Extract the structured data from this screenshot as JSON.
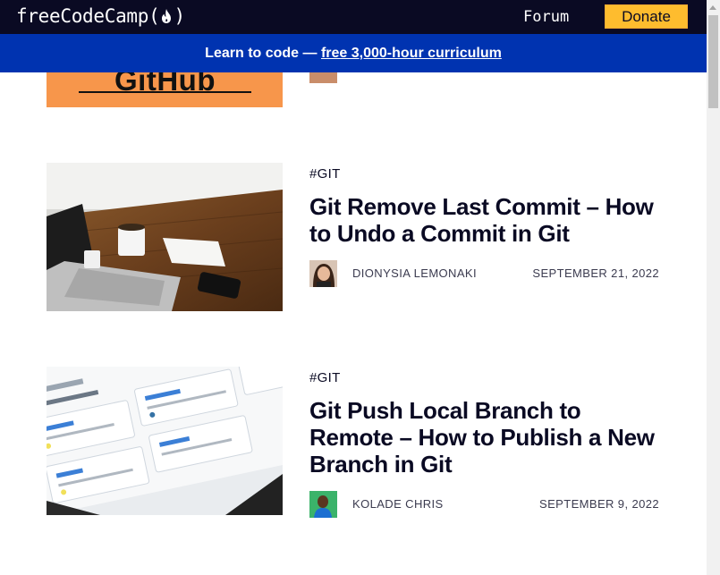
{
  "nav": {
    "logo_text": "freeCodeCamp",
    "logo_paren_open": "(",
    "logo_paren_close": ")",
    "forum_label": "Forum",
    "donate_label": "Donate"
  },
  "banner": {
    "prefix": "Learn to code — ",
    "link_text": "free 3,000-hour curriculum"
  },
  "previous_card": {
    "thumbnail_text": "GitHub"
  },
  "articles": [
    {
      "tag": "#GIT",
      "title": "Git Remove Last Commit – How to Undo a Commit in Git",
      "author": "DIONYSIA LEMONAKI",
      "date": "SEPTEMBER 21, 2022"
    },
    {
      "tag": "#GIT",
      "title": "Git Push Local Branch to Remote – How to Publish a New Branch in Git",
      "author": "KOLADE CHRIS",
      "date": "SEPTEMBER 9, 2022"
    }
  ],
  "colors": {
    "nav_bg": "#0a0a23",
    "banner_bg": "#0033b0",
    "donate_bg": "#febc2e",
    "text": "#0a0a23",
    "meta_text": "#3b3b4f"
  },
  "icons": {
    "logo_flame": "flame-icon"
  }
}
